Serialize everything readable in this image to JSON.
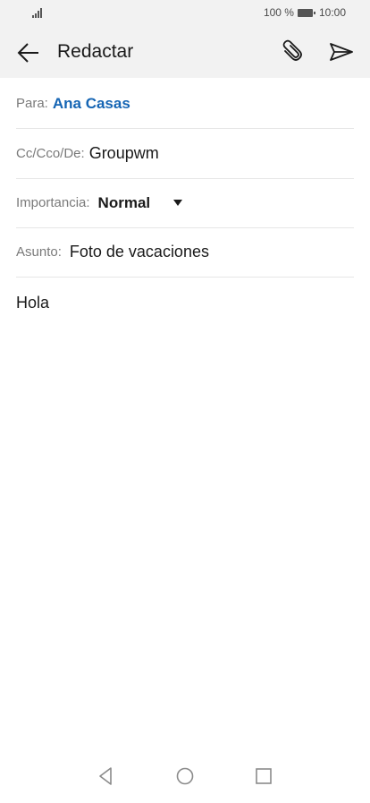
{
  "status_bar": {
    "battery_text": "100 %",
    "time": "10:00"
  },
  "header": {
    "title": "Redactar",
    "icons": [
      "back-arrow-icon",
      "paperclip-icon",
      "send-icon"
    ]
  },
  "compose": {
    "to_label": "Para:",
    "to_value": "Ana Casas",
    "cc_label": "Cc/Cco/De:",
    "cc_value": "Groupwm",
    "importance_label": "Importancia:",
    "importance_value": "Normal",
    "subject_label": "Asunto:",
    "subject_value": "Foto de vacaciones",
    "body": "Hola"
  },
  "colors": {
    "accent": "#1565b4",
    "bar_background": "#f2f2f2"
  },
  "nav_icons": [
    "nav-back-icon",
    "nav-home-icon",
    "nav-recents-icon"
  ]
}
